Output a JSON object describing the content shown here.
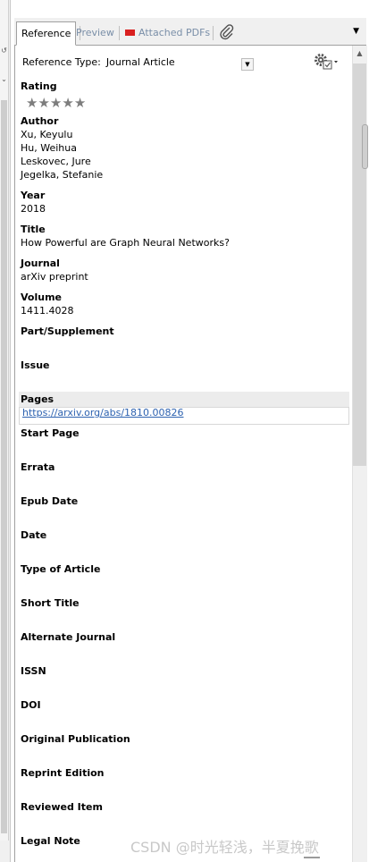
{
  "tabs": [
    {
      "label": "Reference",
      "active": true
    },
    {
      "label": "Preview",
      "active": false
    },
    {
      "label": "Attached PDFs",
      "active": false
    }
  ],
  "reference_type": {
    "label": "Reference Type:",
    "value": "Journal Article"
  },
  "rating": {
    "label": "Rating",
    "stars": 5,
    "filled": 0
  },
  "fields": [
    {
      "label": "Author",
      "values": [
        "Xu, Keyulu",
        "Hu, Weihua",
        "Leskovec, Jure",
        "Jegelka, Stefanie"
      ]
    },
    {
      "label": "Year",
      "values": [
        "2018"
      ]
    },
    {
      "label": "Title",
      "values": [
        "How Powerful are Graph Neural Networks?"
      ]
    },
    {
      "label": "Journal",
      "values": [
        "arXiv preprint"
      ]
    },
    {
      "label": "Volume",
      "values": [
        "1411.4028"
      ]
    },
    {
      "label": "Part/Supplement",
      "values": []
    },
    {
      "label": "Issue",
      "values": []
    },
    {
      "label": "Pages",
      "values": [
        "https://arxiv.org/abs/1810.00826"
      ],
      "link": true,
      "selected": true
    },
    {
      "label": "Start Page",
      "values": []
    },
    {
      "label": "Errata",
      "values": []
    },
    {
      "label": "Epub Date",
      "values": []
    },
    {
      "label": "Date",
      "values": []
    },
    {
      "label": "Type of Article",
      "values": []
    },
    {
      "label": "Short Title",
      "values": []
    },
    {
      "label": "Alternate Journal",
      "values": []
    },
    {
      "label": "ISSN",
      "values": []
    },
    {
      "label": "DOI",
      "values": []
    },
    {
      "label": "Original Publication",
      "values": []
    },
    {
      "label": "Reprint Edition",
      "values": []
    },
    {
      "label": "Reviewed Item",
      "values": []
    },
    {
      "label": "Legal Note",
      "values": []
    }
  ],
  "watermark": "CSDN @时光轻浅，半夏挽歌",
  "icons": {
    "pdf": "pdf-icon",
    "attach": "paperclip-icon",
    "gear": "gear-icon",
    "dropdown": "chevron-down-icon"
  },
  "colors": {
    "link": "#2d62b0",
    "pdf": "#d92020",
    "inactive_tab": "#7a8fa8"
  }
}
